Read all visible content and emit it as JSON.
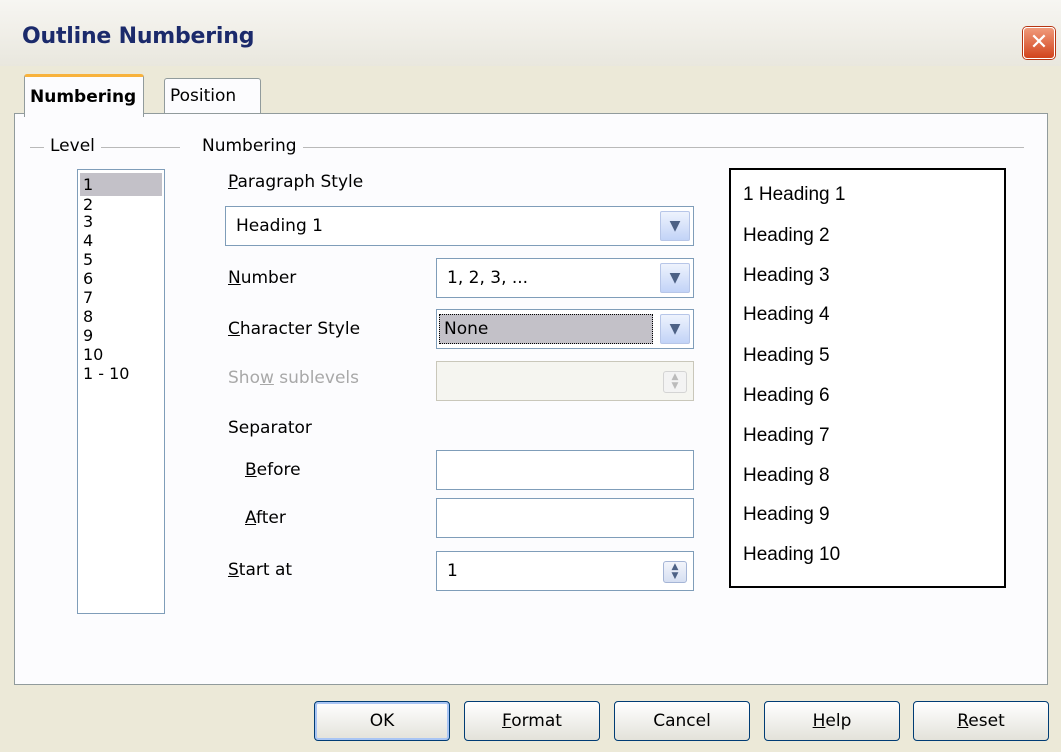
{
  "window": {
    "title": "Outline Numbering",
    "close_glyph": "✕"
  },
  "tabs": [
    {
      "label": "Numbering"
    },
    {
      "label": "Position"
    }
  ],
  "level": {
    "group_label": "Level",
    "items": [
      "1",
      "2",
      "3",
      "4",
      "5",
      "6",
      "7",
      "8",
      "9",
      "10",
      "1 - 10"
    ],
    "selected": "1"
  },
  "numbering": {
    "group_label": "Numbering",
    "paragraph_style": {
      "label_u": "P",
      "label_rest": "aragraph Style",
      "value": "Heading 1"
    },
    "number": {
      "label_u": "N",
      "label_rest": "umber",
      "value": "1, 2, 3, ..."
    },
    "character_style": {
      "label_u": "C",
      "label_rest": "haracter Style",
      "value": "None"
    },
    "show_sublevels": {
      "label_pre": "Sho",
      "label_u": "w",
      "label_rest": " sublevels",
      "value": ""
    },
    "separator_label": "Separator",
    "before": {
      "label_u": "B",
      "label_rest": "efore",
      "value": ""
    },
    "after": {
      "label_u": "A",
      "label_rest": "fter",
      "value": ""
    },
    "start_at": {
      "label_u": "S",
      "label_rest": "tart at",
      "value": "1"
    }
  },
  "preview": [
    "1 Heading 1",
    "Heading 2",
    "Heading 3",
    "Heading 4",
    "Heading 5",
    "Heading 6",
    "Heading 7",
    "Heading 8",
    "Heading 9",
    "Heading 10"
  ],
  "buttons": {
    "ok": {
      "label": "OK"
    },
    "format": {
      "label_u": "F",
      "label_rest": "ormat"
    },
    "cancel": {
      "label": "Cancel"
    },
    "help": {
      "label_u": "H",
      "label_rest": "elp"
    },
    "reset": {
      "label_u": "R",
      "label_rest": "eset"
    }
  },
  "colors": {
    "accent_tab": "#f8b23c",
    "title_text": "#1b2a6b",
    "close_button": "#d2431c",
    "selection": "#c3c1c8"
  },
  "icons": {
    "dropdown": "chevron-down-icon",
    "spin": "spin-arrows-icon",
    "close": "close-icon"
  }
}
